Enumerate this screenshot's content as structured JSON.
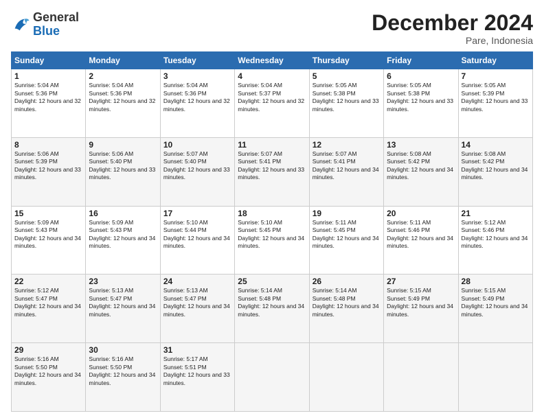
{
  "logo": {
    "general": "General",
    "blue": "Blue"
  },
  "header": {
    "month": "December 2024",
    "location": "Pare, Indonesia"
  },
  "weekdays": [
    "Sunday",
    "Monday",
    "Tuesday",
    "Wednesday",
    "Thursday",
    "Friday",
    "Saturday"
  ],
  "weeks": [
    [
      {
        "day": "1",
        "rise": "5:04 AM",
        "set": "5:36 PM",
        "daylight": "12 hours and 32 minutes."
      },
      {
        "day": "2",
        "rise": "5:04 AM",
        "set": "5:36 PM",
        "daylight": "12 hours and 32 minutes."
      },
      {
        "day": "3",
        "rise": "5:04 AM",
        "set": "5:36 PM",
        "daylight": "12 hours and 32 minutes."
      },
      {
        "day": "4",
        "rise": "5:04 AM",
        "set": "5:37 PM",
        "daylight": "12 hours and 32 minutes."
      },
      {
        "day": "5",
        "rise": "5:05 AM",
        "set": "5:38 PM",
        "daylight": "12 hours and 33 minutes."
      },
      {
        "day": "6",
        "rise": "5:05 AM",
        "set": "5:38 PM",
        "daylight": "12 hours and 33 minutes."
      },
      {
        "day": "7",
        "rise": "5:05 AM",
        "set": "5:39 PM",
        "daylight": "12 hours and 33 minutes."
      }
    ],
    [
      {
        "day": "8",
        "rise": "5:06 AM",
        "set": "5:39 PM",
        "daylight": "12 hours and 33 minutes."
      },
      {
        "day": "9",
        "rise": "5:06 AM",
        "set": "5:40 PM",
        "daylight": "12 hours and 33 minutes."
      },
      {
        "day": "10",
        "rise": "5:07 AM",
        "set": "5:40 PM",
        "daylight": "12 hours and 33 minutes."
      },
      {
        "day": "11",
        "rise": "5:07 AM",
        "set": "5:41 PM",
        "daylight": "12 hours and 33 minutes."
      },
      {
        "day": "12",
        "rise": "5:07 AM",
        "set": "5:41 PM",
        "daylight": "12 hours and 34 minutes."
      },
      {
        "day": "13",
        "rise": "5:08 AM",
        "set": "5:42 PM",
        "daylight": "12 hours and 34 minutes."
      },
      {
        "day": "14",
        "rise": "5:08 AM",
        "set": "5:42 PM",
        "daylight": "12 hours and 34 minutes."
      }
    ],
    [
      {
        "day": "15",
        "rise": "5:09 AM",
        "set": "5:43 PM",
        "daylight": "12 hours and 34 minutes."
      },
      {
        "day": "16",
        "rise": "5:09 AM",
        "set": "5:43 PM",
        "daylight": "12 hours and 34 minutes."
      },
      {
        "day": "17",
        "rise": "5:10 AM",
        "set": "5:44 PM",
        "daylight": "12 hours and 34 minutes."
      },
      {
        "day": "18",
        "rise": "5:10 AM",
        "set": "5:45 PM",
        "daylight": "12 hours and 34 minutes."
      },
      {
        "day": "19",
        "rise": "5:11 AM",
        "set": "5:45 PM",
        "daylight": "12 hours and 34 minutes."
      },
      {
        "day": "20",
        "rise": "5:11 AM",
        "set": "5:46 PM",
        "daylight": "12 hours and 34 minutes."
      },
      {
        "day": "21",
        "rise": "5:12 AM",
        "set": "5:46 PM",
        "daylight": "12 hours and 34 minutes."
      }
    ],
    [
      {
        "day": "22",
        "rise": "5:12 AM",
        "set": "5:47 PM",
        "daylight": "12 hours and 34 minutes."
      },
      {
        "day": "23",
        "rise": "5:13 AM",
        "set": "5:47 PM",
        "daylight": "12 hours and 34 minutes."
      },
      {
        "day": "24",
        "rise": "5:13 AM",
        "set": "5:47 PM",
        "daylight": "12 hours and 34 minutes."
      },
      {
        "day": "25",
        "rise": "5:14 AM",
        "set": "5:48 PM",
        "daylight": "12 hours and 34 minutes."
      },
      {
        "day": "26",
        "rise": "5:14 AM",
        "set": "5:48 PM",
        "daylight": "12 hours and 34 minutes."
      },
      {
        "day": "27",
        "rise": "5:15 AM",
        "set": "5:49 PM",
        "daylight": "12 hours and 34 minutes."
      },
      {
        "day": "28",
        "rise": "5:15 AM",
        "set": "5:49 PM",
        "daylight": "12 hours and 34 minutes."
      }
    ],
    [
      {
        "day": "29",
        "rise": "5:16 AM",
        "set": "5:50 PM",
        "daylight": "12 hours and 34 minutes."
      },
      {
        "day": "30",
        "rise": "5:16 AM",
        "set": "5:50 PM",
        "daylight": "12 hours and 34 minutes."
      },
      {
        "day": "31",
        "rise": "5:17 AM",
        "set": "5:51 PM",
        "daylight": "12 hours and 33 minutes."
      },
      null,
      null,
      null,
      null
    ]
  ],
  "labels": {
    "sunrise": "Sunrise:",
    "sunset": "Sunset:",
    "daylight": "Daylight:"
  }
}
